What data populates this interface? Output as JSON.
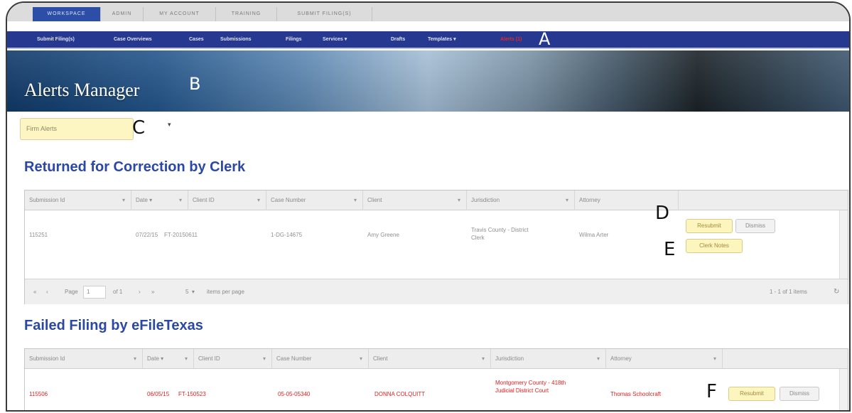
{
  "top_tabs": [
    "WORKSPACE",
    "ADMIN",
    "MY ACCOUNT",
    "TRAINING",
    "SUBMIT FILING(S)"
  ],
  "nav": {
    "items": [
      "Submit Filing(s)",
      "Case Overviews",
      "Cases",
      "Submissions",
      "Filings",
      "Services",
      "Drafts",
      "Templates",
      "Alerts"
    ],
    "services_arrow": "▾",
    "templates_arrow": "▾",
    "alerts_count": "(1)"
  },
  "banner": {
    "title": "Alerts Manager"
  },
  "callouts": {
    "A": "A",
    "B": "B",
    "C": "C",
    "D": "D",
    "E": "E",
    "F": "F"
  },
  "filter": {
    "value": "Firm Alerts",
    "arrow": "▾"
  },
  "returned": {
    "title": "Returned for Correction by Clerk",
    "columns": [
      "Submission Id",
      "Date ▾",
      "Client ID",
      "Case Number",
      "Client",
      "Jurisdiction",
      "Attorney"
    ],
    "header_arrow": "▾",
    "row": {
      "submission_id": "115251",
      "date": "07/22/15",
      "client_id": "FT-20150611",
      "case_number": "1-DG-14675",
      "client": "Amy Greene",
      "jurisdiction": "Travis County - District Clerk",
      "attorney": "Wilma Arter"
    },
    "buttons": {
      "resubmit": "Resubmit",
      "dismiss": "Dismiss",
      "clerk_notes": "Clerk Notes"
    },
    "pager": {
      "first": "«",
      "prev": "‹",
      "page_label": "Page",
      "page_value": "1",
      "of_label": "of 1",
      "next": "›",
      "last": "»",
      "per_page_value": "5",
      "per_page_arrow": "▾",
      "items_per_page": "items per page",
      "summary": "1 - 1 of 1 items",
      "refresh": "↻"
    }
  },
  "failed": {
    "title": "Failed Filing by eFileTexas",
    "columns": [
      "Submission Id",
      "Date ▾",
      "Client ID",
      "Case Number",
      "Client",
      "Jurisdiction",
      "Attorney"
    ],
    "header_arrow": "▾",
    "row": {
      "submission_id": "115506",
      "date": "06/05/15",
      "client_id": "FT-150523",
      "case_number": "05-05-05340",
      "client": "DONNA COLQUITT",
      "jurisdiction": "Montgomery County - 418th Judicial District Court",
      "attorney": "Thomas Schoolcraft"
    },
    "buttons": {
      "resubmit": "Resubmit",
      "dismiss": "Dismiss"
    }
  }
}
